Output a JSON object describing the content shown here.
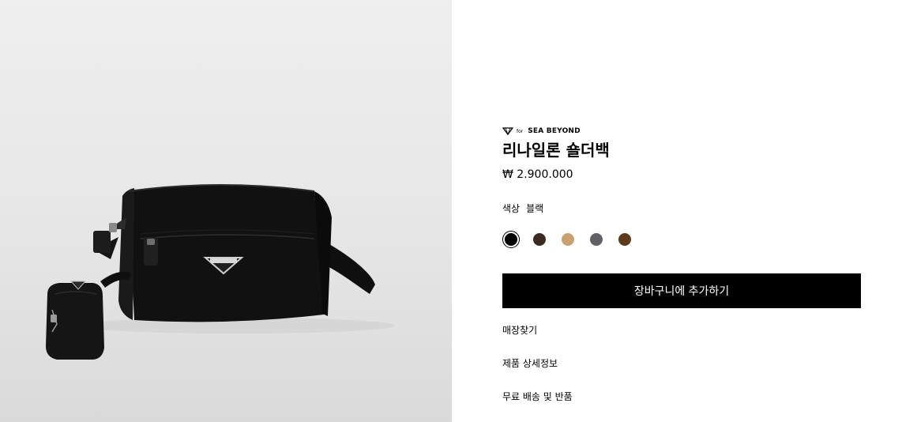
{
  "brand": {
    "for_text": "for",
    "name": "SEA BEYOND"
  },
  "product": {
    "title": "리나일론 숄더백",
    "price": "₩ 2.900.000",
    "image_alt": "PRADA"
  },
  "color": {
    "label": "색상",
    "selected": "블랙",
    "swatches": [
      {
        "name": "블랙",
        "hex": "#000000",
        "selected": true
      },
      {
        "name": "brown",
        "hex": "#3b2a22",
        "selected": false
      },
      {
        "name": "camel",
        "hex": "#c9a070",
        "selected": false
      },
      {
        "name": "gray",
        "hex": "#5f6163",
        "selected": false
      },
      {
        "name": "chestnut",
        "hex": "#5e3a1c",
        "selected": false
      }
    ]
  },
  "actions": {
    "add_to_cart": "장바구니에 추가하기"
  },
  "links": {
    "find_store": "매장찾기",
    "product_details": "제품 상세정보",
    "shipping_returns": "무료 배송 및 반품"
  }
}
